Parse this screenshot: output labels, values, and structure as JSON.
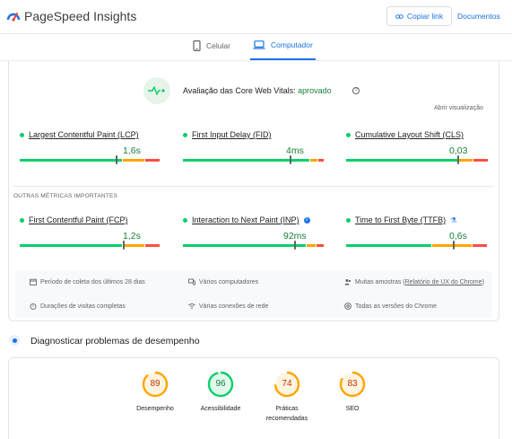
{
  "header": {
    "app_title": "PageSpeed Insights",
    "copy_link_label": "Copiar link",
    "docs_label": "Documentos"
  },
  "device_tabs": [
    {
      "label": "Celular",
      "icon": "smartphone-icon",
      "selected": false
    },
    {
      "label": "Computador",
      "icon": "laptop-icon",
      "selected": true
    }
  ],
  "core_web_vitals": {
    "title": "Avaliação das Core Web Vitals:",
    "status": "aprovado",
    "expand_label": "Abrir visualização",
    "metrics": [
      {
        "name": "Largest Contentful Paint (LCP)",
        "value": "1,6s",
        "bar": [
          70,
          15,
          10
        ],
        "marker": 0.68
      },
      {
        "name": "First Input Delay (FID)",
        "value": "4ms",
        "bar": [
          88,
          5,
          4
        ],
        "marker": 0.76
      },
      {
        "name": "Cumulative Layout Shift (CLS)",
        "value": "0,03",
        "bar": [
          80,
          10,
          10
        ],
        "marker": 0.79
      }
    ]
  },
  "other_metrics": {
    "section_label": "OUTRAS MÉTRICAS IMPORTANTES",
    "metrics": [
      {
        "name": "First Contentful Paint (FCP)",
        "value": "1,2s",
        "bar": [
          70,
          15,
          10
        ],
        "marker": 0.73,
        "badge": ""
      },
      {
        "name": "Interaction to Next Paint (INP)",
        "value": "92ms",
        "bar": [
          86,
          6,
          5
        ],
        "marker": 0.79,
        "badge": "info-icon"
      },
      {
        "name": "Time to First Byte (TTFB)",
        "value": "0,6s",
        "bar": [
          60,
          28,
          10
        ],
        "marker": 0.76,
        "badge": "flask-icon"
      }
    ]
  },
  "collection_info": {
    "period": "Período de coleta dos últimos 28 dias",
    "devices": "Vários computadores",
    "samples_prefix": "Muitas amostras (",
    "samples_link": "Relatório de UX do Chrome",
    "samples_suffix": ")",
    "durations": "Durações de visitas completas",
    "connections": "Várias conexões de rede",
    "versions": "Todas as versões do Chrome"
  },
  "diagnose": {
    "title": "Diagnosticar problemas de desempenho",
    "scores": [
      {
        "label": "Desempenho",
        "score": 89,
        "color": "#ffa400"
      },
      {
        "label": "Acessibilidade",
        "score": 96,
        "color": "#0cce6b"
      },
      {
        "label": "Práticas recomendadas",
        "score": 74,
        "color": "#ffa400"
      },
      {
        "label": "SEO",
        "score": 83,
        "color": "#ffa400"
      }
    ]
  },
  "colors": {
    "accent": "#1a73e8",
    "good": "#0cce6b",
    "average": "#ffa400",
    "poor": "#ff4e42",
    "good_text": "#188038",
    "average_text": "#c33300"
  }
}
